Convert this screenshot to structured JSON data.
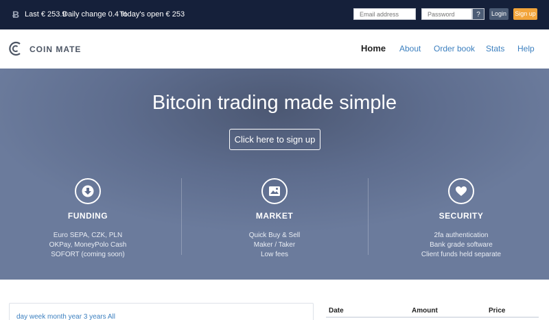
{
  "ticker": {
    "last": "Last € 253.9",
    "change": "Daily change 0.4 %",
    "open": "Today's open € 253"
  },
  "auth": {
    "email_placeholder": "Email address",
    "password_placeholder": "Password",
    "help_label": "?",
    "login_label": "Login",
    "signup_label": "Sign up"
  },
  "brand": {
    "name": "COIN MATE"
  },
  "nav": {
    "home": "Home",
    "about": "About",
    "orderbook": "Order book",
    "stats": "Stats",
    "help": "Help"
  },
  "hero": {
    "title": "Bitcoin trading made simple",
    "cta": "Click here to sign up"
  },
  "features": {
    "funding": {
      "title": "FUNDING",
      "lines": [
        "Euro SEPA, CZK, PLN",
        "OKPay, MoneyPolo Cash",
        "SOFORT (coming soon)"
      ]
    },
    "market": {
      "title": "MARKET",
      "lines": [
        "Quick Buy & Sell",
        "Maker / Taker",
        "Low fees"
      ]
    },
    "security": {
      "title": "SECURITY",
      "lines": [
        "2fa authentication",
        "Bank grade software",
        "Client funds held separate"
      ]
    }
  },
  "chart": {
    "periods": "day week month year 3 years All"
  },
  "trades": {
    "date": "Date",
    "amount": "Amount",
    "price": "Price"
  },
  "colors": {
    "topbar": "#15203a",
    "accent": "#f2a43a",
    "link": "#3b7fbf",
    "hero": "#5e6d8e"
  }
}
